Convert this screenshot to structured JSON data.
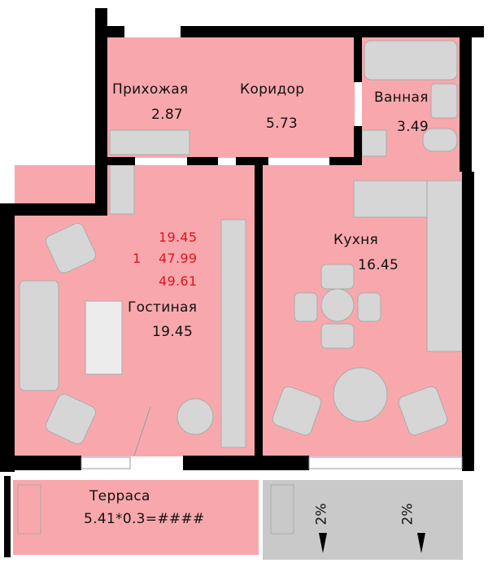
{
  "colors": {
    "room_fill": "#f8a8ac",
    "wall": "#000000",
    "furniture": "#d4d4d4",
    "terrace_gray": "#c9c9c9",
    "area_summary_text": "#e0141e"
  },
  "rooms": {
    "hallway": {
      "name": "Прихожая",
      "area": "2.87"
    },
    "corridor": {
      "name": "Коридор",
      "area": "5.73"
    },
    "bathroom": {
      "name": "Ванная",
      "area": "3.49"
    },
    "kitchen": {
      "name": "Кухня",
      "area": "16.45"
    },
    "living": {
      "name": "Гостиная",
      "area": "19.45"
    },
    "terrace": {
      "name": "Терраса",
      "area": "5.41*0.3=####"
    }
  },
  "summary": {
    "rooms_count": "1",
    "living_area": "19.45",
    "total_area": "47.99",
    "total_with_terrace": "49.61"
  },
  "slopes": [
    "2%",
    "2%"
  ]
}
